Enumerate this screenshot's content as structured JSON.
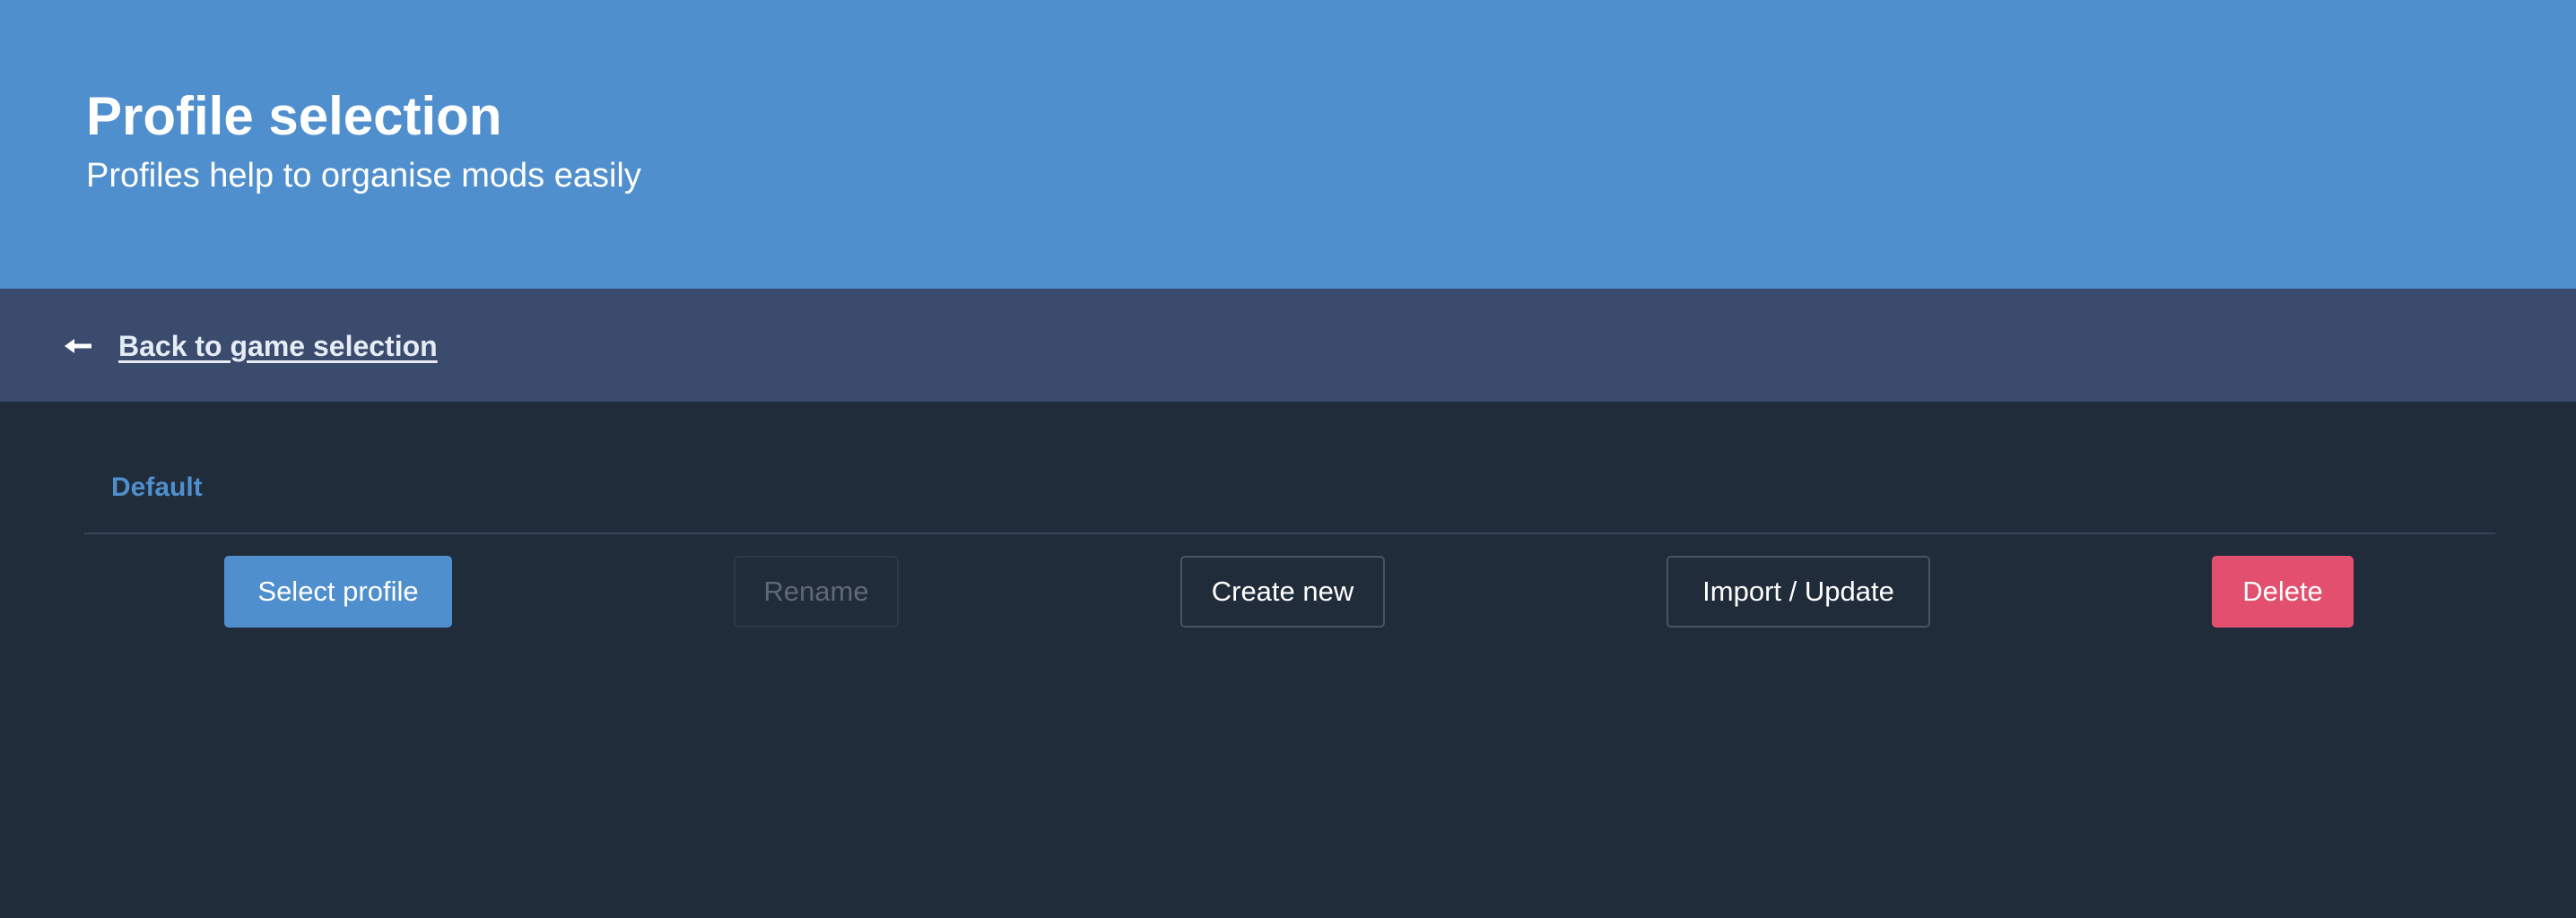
{
  "header": {
    "title": "Profile selection",
    "subtitle": "Profiles help to organise mods easily"
  },
  "nav": {
    "back_icon": "arrow-left-icon",
    "back_label": "Back to game selection"
  },
  "profile": {
    "name": "Default"
  },
  "actions": {
    "select_label": "Select profile",
    "rename_label": "Rename",
    "create_label": "Create new",
    "import_label": "Import / Update",
    "delete_label": "Delete"
  },
  "colors": {
    "hero_bg": "#508fcd",
    "nav_bg": "#3a4b6d",
    "page_bg": "#212c3b",
    "accent": "#508fcd",
    "danger": "#e34f6e"
  }
}
